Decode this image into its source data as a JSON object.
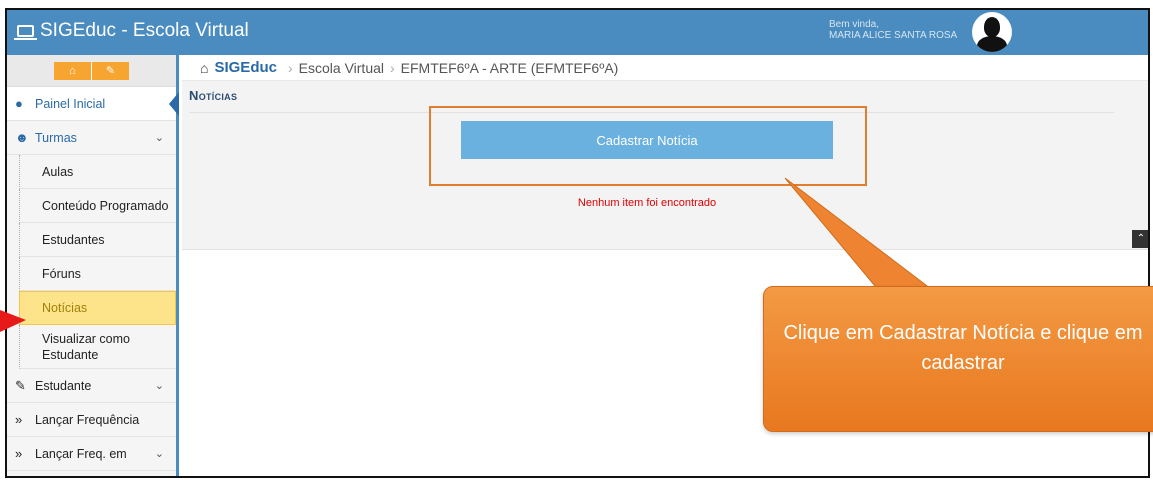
{
  "app": {
    "title": "SIGEduc - Escola Virtual",
    "laptop_icon": "laptop-icon"
  },
  "user": {
    "welcome": "Bem vinda,",
    "name": "MARIA ALICE SANTA ROSA"
  },
  "sidebar": {
    "tool_icons": [
      "home-icon",
      "pencil-icon"
    ],
    "items": [
      {
        "label": "Painel Inicial",
        "icon": "dashboard-icon"
      },
      {
        "label": "Turmas",
        "icon": "users-icon"
      },
      {
        "label": "Aulas"
      },
      {
        "label": "Conteúdo Programado"
      },
      {
        "label": "Estudantes"
      },
      {
        "label": "Fóruns"
      },
      {
        "label": "Notícias"
      },
      {
        "label": "Visualizar como Estudante"
      },
      {
        "label": "Estudante",
        "icon": "edit-icon"
      },
      {
        "label": "Lançar Frequência",
        "icon": "double-chevron-icon"
      },
      {
        "label": "Lançar Freq. em",
        "icon": "double-chevron-icon"
      }
    ],
    "active_item": "Notícias",
    "accent": "#4a8bc0",
    "active_bg": "#fde48a"
  },
  "breadcrumb": {
    "root": "SIGEduc",
    "sep": "›",
    "items": [
      "Escola Virtual",
      "EFMTEF6ºA - ARTE (EFMTEF6ºA)"
    ]
  },
  "panel": {
    "title": "Notícias",
    "button_label": "Cadastrar Notícia",
    "empty_message": "Nenhum item foi encontrado",
    "button_color": "#6bb1df",
    "error_color": "#e00000"
  },
  "callout": {
    "text": "Clique em Cadastrar Notícia e clique em cadastrar",
    "color": "#f08c36"
  }
}
